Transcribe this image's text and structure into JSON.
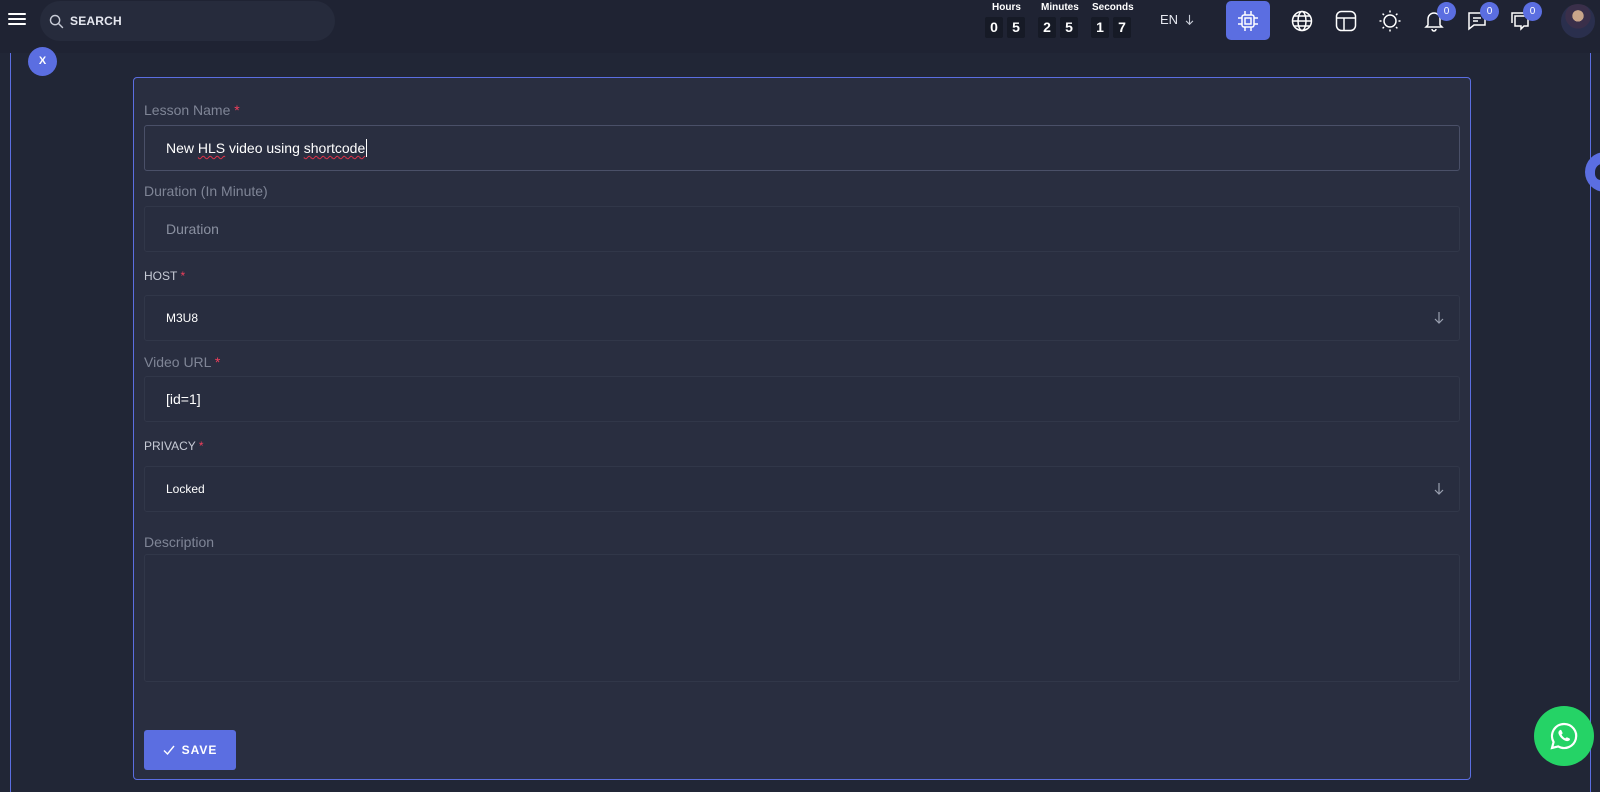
{
  "topbar": {
    "search_label": "SEARCH",
    "countdown": {
      "hours_label": "Hours",
      "minutes_label": "Minutes",
      "seconds_label": "Seconds",
      "hours": [
        "0",
        "5"
      ],
      "minutes": [
        "2",
        "5"
      ],
      "seconds": [
        "1",
        "7"
      ]
    },
    "language": "EN",
    "notifications_count": "0",
    "messages_count": "0",
    "chat_count": "0"
  },
  "close_label": "X",
  "form": {
    "lesson_name_label": "Lesson Name",
    "lesson_name_value_part1": "New ",
    "lesson_name_value_misspelled": "HLS",
    "lesson_name_value_part2": " video using ",
    "lesson_name_value_misspelled2": "shortcode",
    "required_mark": "*",
    "duration_label": "Duration (In Minute)",
    "duration_placeholder": "Duration",
    "host_label": "HOST",
    "host_value": "M3U8",
    "video_url_label": "Video URL",
    "video_url_value": "[id=1]",
    "privacy_label": "PRIVACY",
    "privacy_value": "Locked",
    "description_label": "Description",
    "save_label": "SAVE"
  },
  "colors": {
    "accent": "#5b6ee1",
    "background": "#212636",
    "card": "#292e40",
    "required": "#ef3f5b",
    "whatsapp": "#25d366"
  }
}
